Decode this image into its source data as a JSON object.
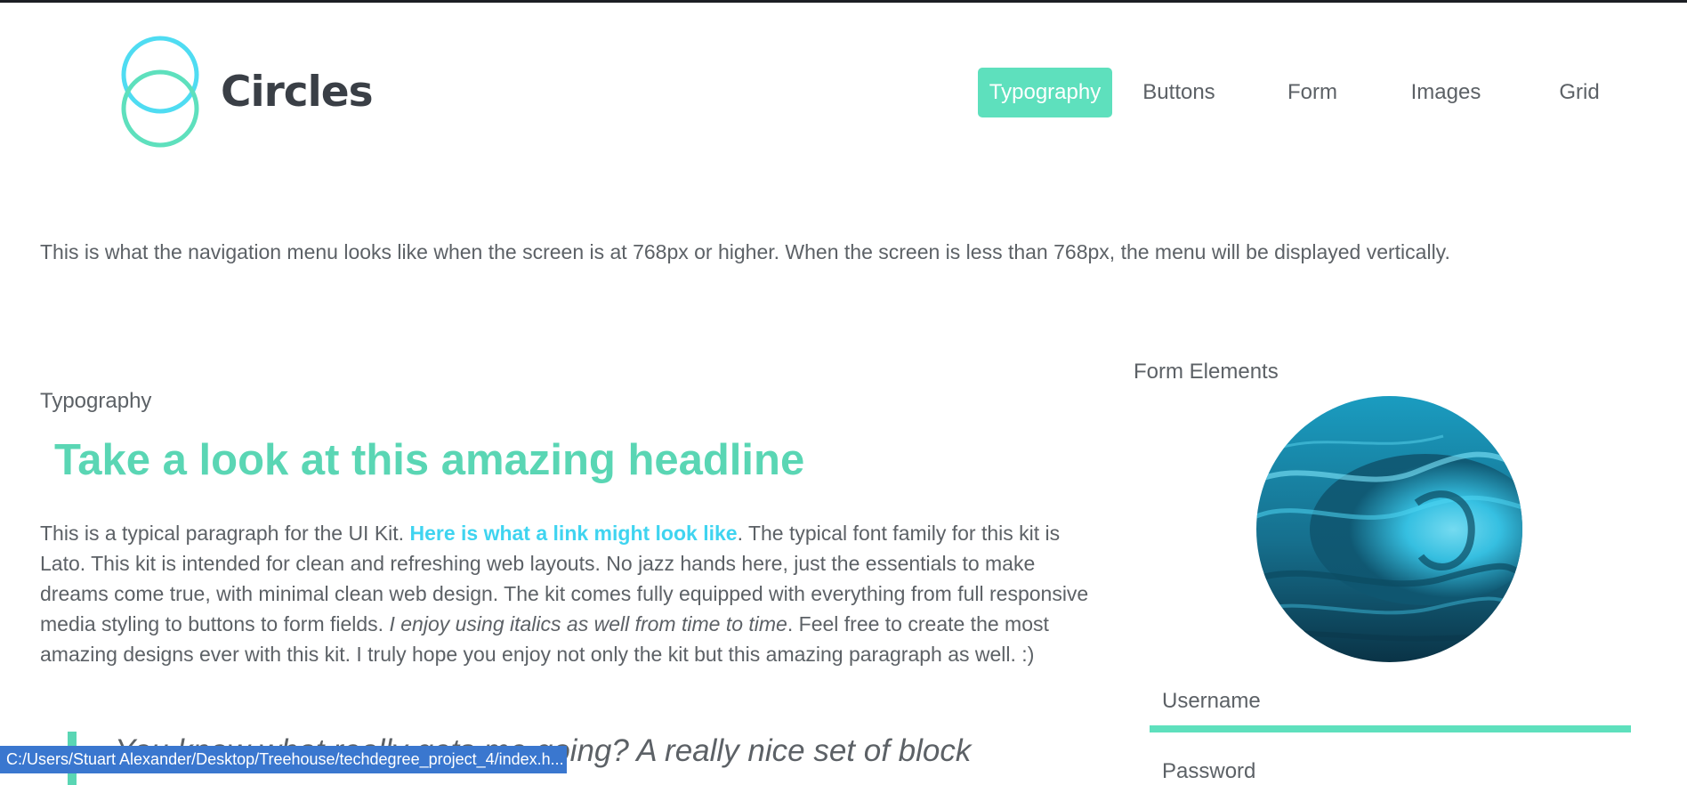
{
  "logo": {
    "text": "Circles",
    "colors": {
      "circle_top": "#4fdcf2",
      "circle_bottom": "#5ee0bd"
    }
  },
  "nav": {
    "items": [
      {
        "label": "Typography",
        "active": true
      },
      {
        "label": "Buttons",
        "active": false
      },
      {
        "label": "Form",
        "active": false
      },
      {
        "label": "Images",
        "active": false
      },
      {
        "label": "Grid",
        "active": false
      }
    ],
    "active_color": "#5ee0bd"
  },
  "intro": {
    "text": "This is what the navigation menu looks like when the screen is at 768px or higher. When the screen is less than 768px, the menu will be displayed vertically."
  },
  "typography": {
    "section_label": "Typography",
    "headline": "Take a look at this amazing headline",
    "paragraph": {
      "part1": "This is a typical paragraph for the UI Kit. ",
      "link": "Here is what a link might look like",
      "part2": ". The typical font family for this kit is Lato. This kit is intended for clean and refreshing web layouts. No jazz hands here, just the essentials to make dreams come true, with minimal clean web design. The kit comes fully equipped with everything from full responsive media styling to buttons to form fields. ",
      "italic": "I enjoy using italics as well from time to time",
      "part3": ". Feel free to create the most amazing designs ever with this kit. I truly hope you enjoy not only the kit but this amazing paragraph as well. :)"
    },
    "blockquote": "You know what really gets me going? A really nice set of block"
  },
  "form": {
    "title": "Form Elements",
    "image_icon": "ocean-wave-image",
    "username_label": "Username",
    "password_label": "Password"
  },
  "statusbar": {
    "text": "C:/Users/Stuart Alexander/Desktop/Treehouse/techdegree_project_4/index.h..."
  },
  "colors": {
    "accent": "#5ee0bd",
    "headline": "#5ad6b4",
    "link": "#3fd4f0",
    "text": "#5c6166"
  }
}
